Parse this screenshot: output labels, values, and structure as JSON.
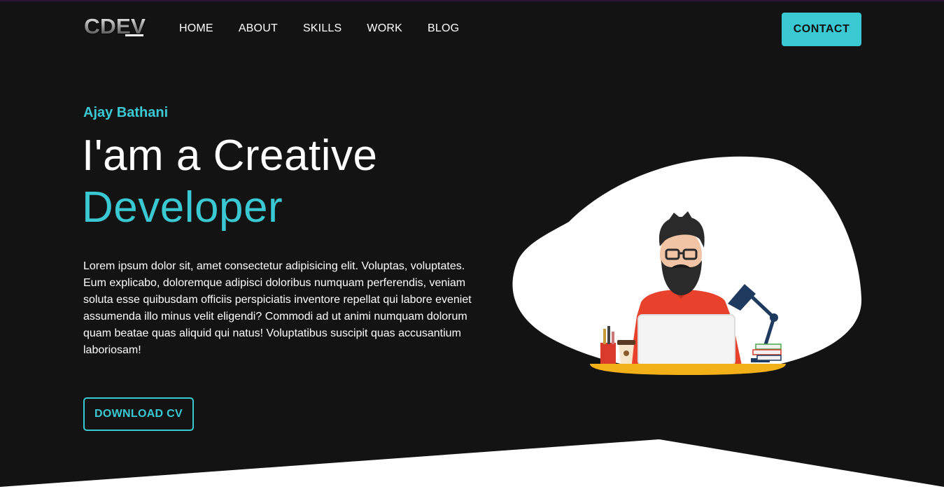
{
  "header": {
    "logo_text": "CDEV",
    "nav": [
      {
        "label": "HOME"
      },
      {
        "label": "ABOUT"
      },
      {
        "label": "SKILLS"
      },
      {
        "label": "WORK"
      },
      {
        "label": "BLOG"
      }
    ],
    "contact_label": "CONTACT"
  },
  "hero": {
    "name": "Ajay Bathani",
    "headline_line1": "I'am a Creative",
    "headline_line2": "Developer",
    "description": "Lorem ipsum dolor sit, amet consectetur adipisicing elit. Voluptas, voluptates. Eum explicabo, doloremque adipisci doloribus numquam perferendis, veniam soluta esse quibusdam officiis perspiciatis inventore repellat qui labore eveniet assumenda illo minus velit eligendi? Commodi ad ut animi numquam dolorum quam beatae quas aliquid qui natus! Voluptatibus suscipit quas accusantium laboriosam!",
    "download_label": "DOWNLOAD CV",
    "illustration_icon": "developer-at-desk-illustration"
  },
  "colors": {
    "background": "#131313",
    "accent": "#3ac9d3",
    "text": "#ffffff"
  }
}
